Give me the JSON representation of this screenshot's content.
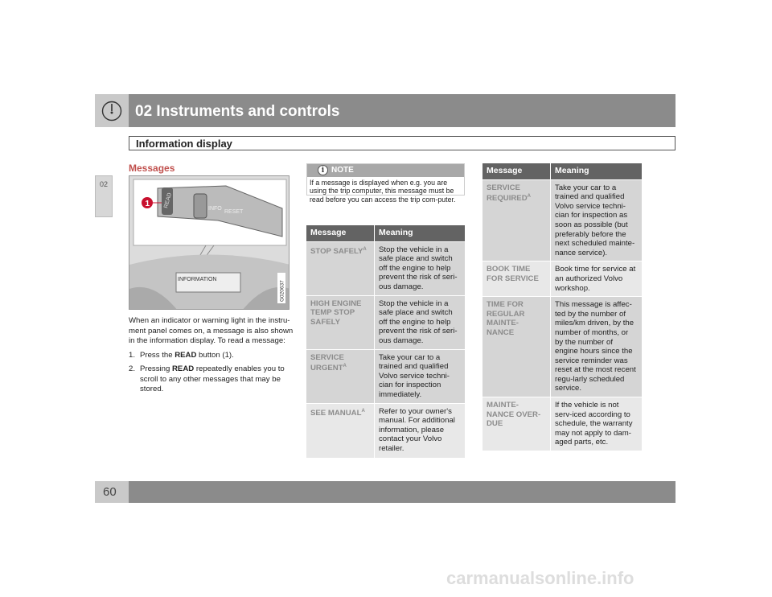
{
  "header": {
    "chapter_title": "02 Instruments and controls",
    "icon": "gauge-icon",
    "section_title": "Information display"
  },
  "side_tab": "02",
  "page_number": "60",
  "left": {
    "heading": "Messages",
    "figure": {
      "callout": "1",
      "button_labels": [
        "READ",
        "INFO",
        "RESET"
      ],
      "display_text": "INFORMATION",
      "image_code": "G020637"
    },
    "intro": "When an indicator or warning light in the instru-ment panel comes on, a message is also shown in the information display. To read a message:",
    "steps": [
      {
        "num": "1.",
        "pre": "Press the ",
        "bold": "READ",
        "post": " button (1)."
      },
      {
        "num": "2.",
        "pre": "Pressing ",
        "bold": "READ",
        "post": " repeatedly enables you to scroll to any other messages that may be stored."
      }
    ]
  },
  "note": {
    "title": "NOTE",
    "icon": "info-icon",
    "text": "If a message is displayed when e.g. you are using the trip computer, this message must be read before you can access the trip com-puter."
  },
  "table1": {
    "headers": [
      "Message",
      "Meaning"
    ],
    "rows": [
      {
        "message": "STOP SAFELY",
        "sup": "A",
        "meaning": "Stop the vehicle in a safe place and switch off the engine to help prevent the risk of seri-ous damage."
      },
      {
        "message": "HIGH ENGINE TEMP STOP SAFELY",
        "sup": "",
        "meaning": "Stop the vehicle in a safe place and switch off the engine to help prevent the risk of seri-ous damage."
      },
      {
        "message": "SERVICE URGENT",
        "sup": "A",
        "meaning": "Take your car to a trained and qualified Volvo service techni-cian for inspection immediately."
      },
      {
        "message": "SEE MANUAL",
        "sup": "A",
        "meaning": "Refer to your owner's manual. For additional information, please contact your Volvo retailer."
      }
    ]
  },
  "table2": {
    "headers": [
      "Message",
      "Meaning"
    ],
    "rows": [
      {
        "message": "SERVICE REQUIRED",
        "sup": "A",
        "meaning": "Take your car to a trained and qualified Volvo service techni-cian for inspection as soon as possible (but preferably before the next scheduled mainte-nance service)."
      },
      {
        "message": "BOOK TIME FOR SERVICE",
        "sup": "",
        "meaning": "Book time for service at an authorized Volvo workshop."
      },
      {
        "message": "TIME FOR REGULAR MAINTE-NANCE",
        "sup": "",
        "meaning": "This message is affec-ted by the number of miles/km driven, by the number of months, or by the number of engine hours since the service reminder was reset at the most recent regu-larly scheduled service."
      },
      {
        "message": "MAINTE-NANCE OVER-DUE",
        "sup": "",
        "meaning": "If the vehicle is not serv-iced according to schedule, the warranty may not apply to dam-aged parts, etc."
      }
    ]
  },
  "watermark": "carmanualsonline.info",
  "colors": {
    "header_bar": "#8b8b8b",
    "heading_red": "#c0504d",
    "table_header": "#636363"
  }
}
